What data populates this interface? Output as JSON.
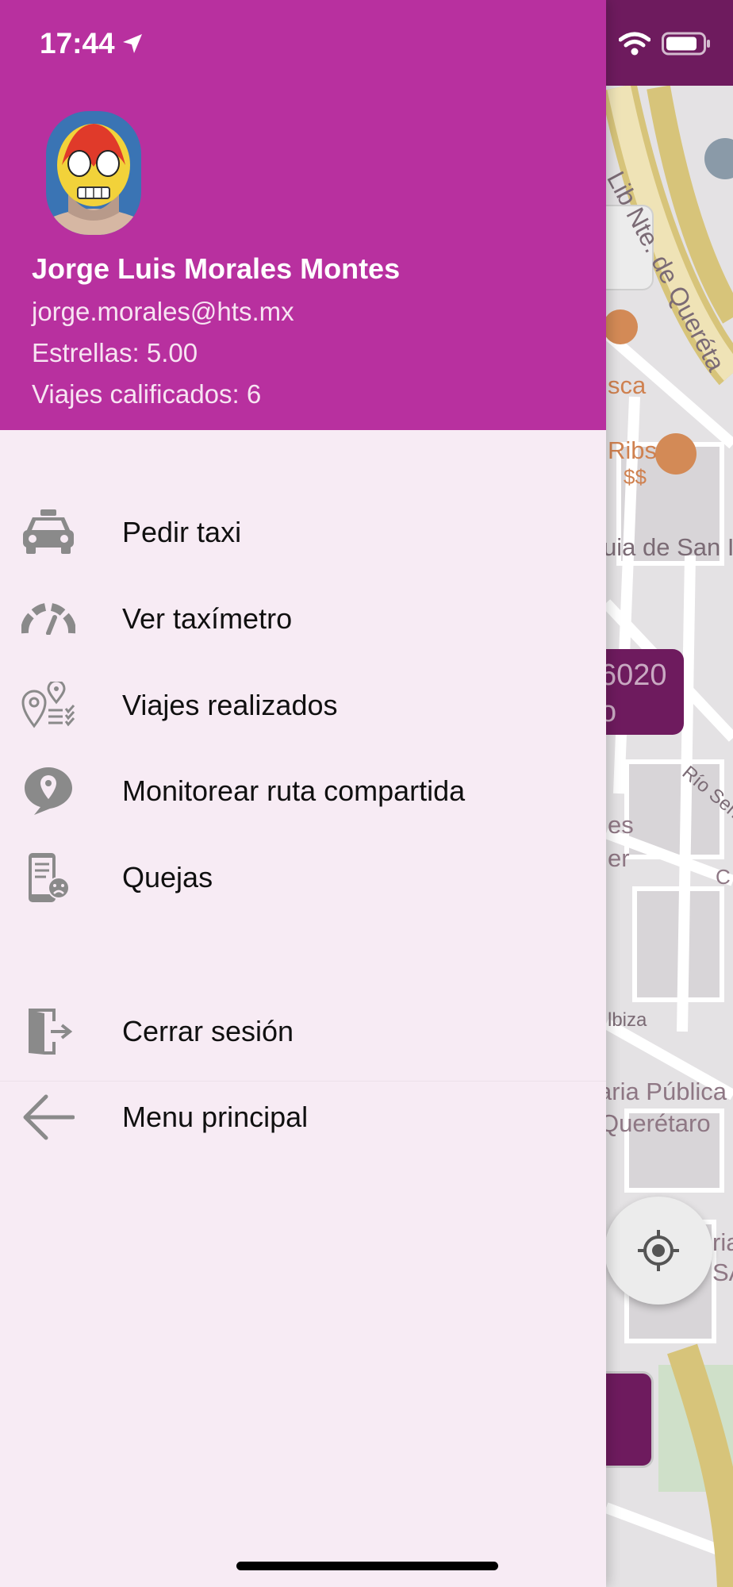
{
  "status_bar": {
    "time": "17:44"
  },
  "user": {
    "name": "Jorge Luis Morales Montes",
    "email": "jorge.morales@hts.mx",
    "stars": "Estrellas: 5.00",
    "rated_trips": "Viajes calificados: 6"
  },
  "menu": [
    {
      "label": "Pedir taxi",
      "icon": "taxi-icon"
    },
    {
      "label": "Ver taxímetro",
      "icon": "taximeter-gauge-icon"
    },
    {
      "label": "Viajes realizados",
      "icon": "trips-history-icon"
    },
    {
      "label": "Monitorear ruta compartida",
      "icon": "shared-route-pin-icon"
    },
    {
      "label": "Quejas",
      "icon": "complaints-phone-icon"
    },
    {
      "label": "Cerrar sesión",
      "icon": "logout-door-icon"
    },
    {
      "label": "Menu principal",
      "icon": "back-arrow-icon"
    }
  ],
  "map": {
    "street_1": "Lib Nte. de Queréta",
    "label_sca": "sca",
    "label_ribs": "Ribs",
    "label_price": "$$",
    "label_guia": "uia de San I",
    "label_rio": "Río Seña",
    "label_es": "es",
    "label_er": "er",
    "label_c": "C",
    "label_ibiza": "lbiza",
    "label_biblioteca_1": "aria Pública",
    "label_biblioteca_2": "Querétaro",
    "label_ria": "ria",
    "label_sa": "SA",
    "address_card_line1": "6020",
    "address_card_line2": "o"
  },
  "colors": {
    "drawer_header": "#b8309f",
    "drawer_body": "#f7ebf4",
    "map_accent": "#6e1b5e",
    "icon_gray": "#8a8a8a"
  }
}
